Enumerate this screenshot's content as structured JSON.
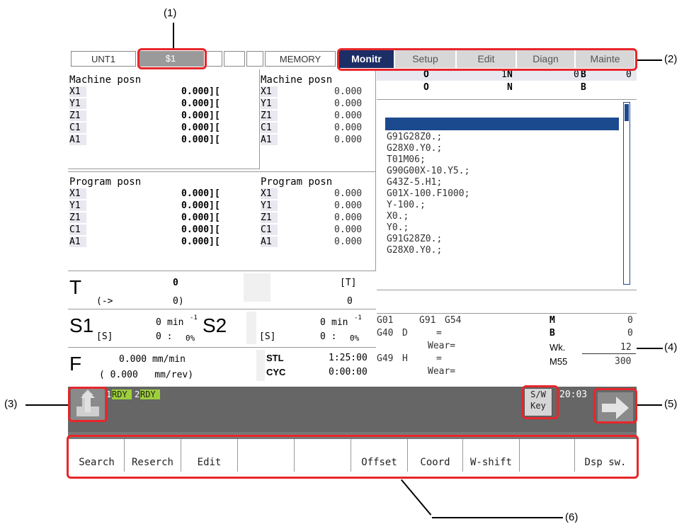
{
  "callouts": {
    "c1": "(1)",
    "c2": "(2)",
    "c3": "(3)",
    "c4": "(4)",
    "c5": "(5)",
    "c6": "(6)"
  },
  "topbar": {
    "unit": "UNT1",
    "system": "$1",
    "mode": "MEMORY"
  },
  "tabs": [
    "Monitr",
    "Setup",
    "Edit",
    "Diagn",
    "Mainte"
  ],
  "machine_posn": {
    "title": "Machine posn",
    "axes": [
      "X1",
      "Y1",
      "Z1",
      "C1",
      "A1"
    ],
    "values": [
      "0.000][",
      "0.000][",
      "0.000][",
      "0.000][",
      "0.000]["
    ],
    "values2": [
      "0.000",
      "0.000",
      "0.000",
      "0.000",
      "0.000"
    ]
  },
  "program_posn": {
    "title": "Program posn",
    "axes": [
      "X1",
      "Y1",
      "Z1",
      "C1",
      "A1"
    ],
    "values": [
      "0.000][",
      "0.000][",
      "0.000][",
      "0.000][",
      "0.000]["
    ],
    "values2": [
      "0.000",
      "0.000",
      "0.000",
      "0.000",
      "0.000"
    ]
  },
  "prog_header": {
    "o1": "O",
    "n1_val": "1",
    "n1": "N",
    "b1_val": "0",
    "b1": "B",
    "b1_end": "0",
    "o2": "O",
    "n2": "N",
    "b2": "B"
  },
  "program_lines": [
    "G91G28Z0.;",
    "G28X0.Y0.;",
    "T01M06;",
    "G90G00X-10.Y5.;",
    "G43Z-5.H1;",
    "G01X-100.F1000;",
    "Y-100.;",
    "X0.;",
    "Y0.;",
    "G91G28Z0.;",
    "G28X0.Y0.;"
  ],
  "tool": {
    "label": "T",
    "val": "0",
    "arrow": "(->",
    "val2": "0)",
    "bracket": "[T]",
    "val3": "0"
  },
  "spindle1": {
    "label": "S1",
    "speed": "0",
    "unit": "min",
    "sup": "-1",
    "s": "[S]",
    "load": "0 :",
    "pct": "0%"
  },
  "spindle2": {
    "label": "S2",
    "speed": "0",
    "unit": "min",
    "sup": "-1",
    "s": "[S]",
    "load": "0 :",
    "pct": "0%"
  },
  "feed": {
    "label": "F",
    "rate": "0.000 mm/min",
    "rev": "( 0.000   mm/rev)"
  },
  "times": {
    "stl_label": "STL",
    "stl": "1:25:00",
    "cyc_label": "CYC",
    "cyc": "0:00:00"
  },
  "modal": {
    "g01": "G01",
    "g91": "G91",
    "g54": "G54",
    "g40": "G40",
    "d": "D",
    "eq1": "=",
    "wear1": "Wear=",
    "g49": "G49",
    "h": "H",
    "eq2": "=",
    "wear2": "Wear=",
    "m": "M",
    "m_val": "0",
    "b": "B",
    "b_val": "0",
    "wk": "Wk.",
    "wk_val": "12",
    "m55": "M55",
    "m55_val": "300"
  },
  "status": {
    "rdy1_num": "1",
    "rdy1": "RDY",
    "rdy2_num": "2",
    "rdy2": "RDY",
    "sw1": "S/W",
    "sw2": "Key",
    "clock": "20:03"
  },
  "softkeys": [
    "Search",
    "Reserch",
    "Edit",
    "",
    "",
    "Offset",
    "Coord",
    "W-shift",
    "",
    "Dsp sw."
  ]
}
